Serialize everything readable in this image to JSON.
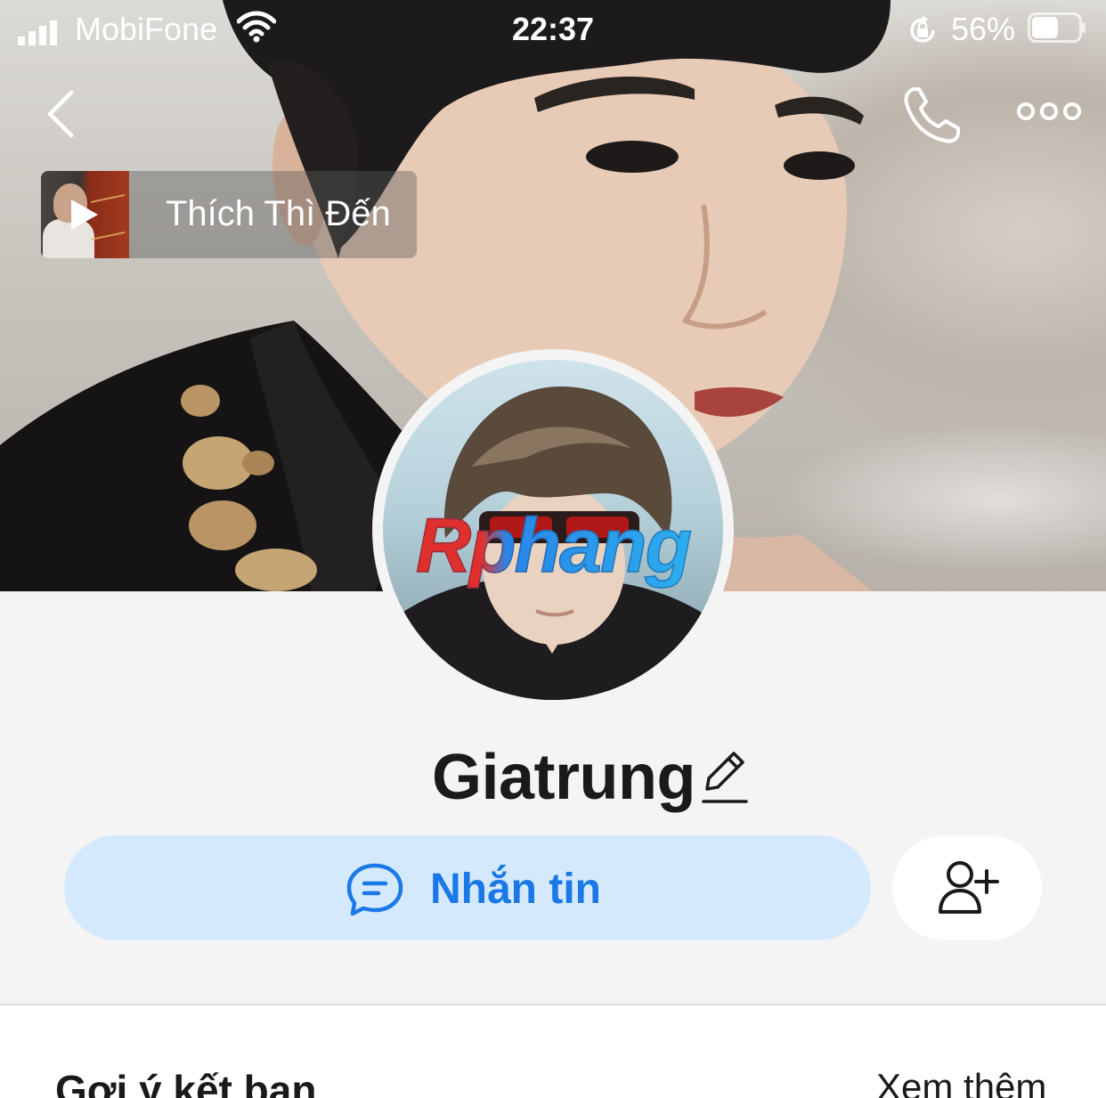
{
  "status_bar": {
    "carrier": "MobiFone",
    "time": "22:37",
    "battery_percent": "56%",
    "battery_level": 0.56
  },
  "nav": {
    "back_icon": "chevron-left-icon",
    "call_icon": "phone-icon",
    "more_icon": "more-horizontal-icon"
  },
  "music": {
    "title": "Thích Thì Đến",
    "play_icon": "play-icon"
  },
  "profile": {
    "name": "Giatrung",
    "avatar_watermark": "Rphang",
    "edit_icon": "pencil-icon"
  },
  "actions": {
    "message_label": "Nhắn tin",
    "message_icon": "chat-bubble-icon",
    "add_friend_icon": "add-user-icon"
  },
  "suggestions": {
    "title": "Gợi ý kết bạn",
    "more_label": "Xem thêm"
  },
  "colors": {
    "accent": "#1a79e6",
    "message_button_bg": "#d5e9fd",
    "page_bg": "#f4f4f4"
  }
}
